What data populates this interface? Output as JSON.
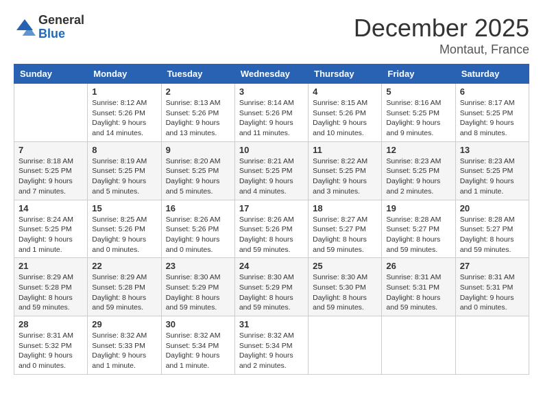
{
  "logo": {
    "general": "General",
    "blue": "Blue"
  },
  "header": {
    "month": "December 2025",
    "location": "Montaut, France"
  },
  "weekdays": [
    "Sunday",
    "Monday",
    "Tuesday",
    "Wednesday",
    "Thursday",
    "Friday",
    "Saturday"
  ],
  "weeks": [
    [
      {
        "day": "",
        "sunrise": "",
        "sunset": "",
        "daylight": ""
      },
      {
        "day": "1",
        "sunrise": "Sunrise: 8:12 AM",
        "sunset": "Sunset: 5:26 PM",
        "daylight": "Daylight: 9 hours and 14 minutes."
      },
      {
        "day": "2",
        "sunrise": "Sunrise: 8:13 AM",
        "sunset": "Sunset: 5:26 PM",
        "daylight": "Daylight: 9 hours and 13 minutes."
      },
      {
        "day": "3",
        "sunrise": "Sunrise: 8:14 AM",
        "sunset": "Sunset: 5:26 PM",
        "daylight": "Daylight: 9 hours and 11 minutes."
      },
      {
        "day": "4",
        "sunrise": "Sunrise: 8:15 AM",
        "sunset": "Sunset: 5:26 PM",
        "daylight": "Daylight: 9 hours and 10 minutes."
      },
      {
        "day": "5",
        "sunrise": "Sunrise: 8:16 AM",
        "sunset": "Sunset: 5:25 PM",
        "daylight": "Daylight: 9 hours and 9 minutes."
      },
      {
        "day": "6",
        "sunrise": "Sunrise: 8:17 AM",
        "sunset": "Sunset: 5:25 PM",
        "daylight": "Daylight: 9 hours and 8 minutes."
      }
    ],
    [
      {
        "day": "7",
        "sunrise": "Sunrise: 8:18 AM",
        "sunset": "Sunset: 5:25 PM",
        "daylight": "Daylight: 9 hours and 7 minutes."
      },
      {
        "day": "8",
        "sunrise": "Sunrise: 8:19 AM",
        "sunset": "Sunset: 5:25 PM",
        "daylight": "Daylight: 9 hours and 5 minutes."
      },
      {
        "day": "9",
        "sunrise": "Sunrise: 8:20 AM",
        "sunset": "Sunset: 5:25 PM",
        "daylight": "Daylight: 9 hours and 5 minutes."
      },
      {
        "day": "10",
        "sunrise": "Sunrise: 8:21 AM",
        "sunset": "Sunset: 5:25 PM",
        "daylight": "Daylight: 9 hours and 4 minutes."
      },
      {
        "day": "11",
        "sunrise": "Sunrise: 8:22 AM",
        "sunset": "Sunset: 5:25 PM",
        "daylight": "Daylight: 9 hours and 3 minutes."
      },
      {
        "day": "12",
        "sunrise": "Sunrise: 8:23 AM",
        "sunset": "Sunset: 5:25 PM",
        "daylight": "Daylight: 9 hours and 2 minutes."
      },
      {
        "day": "13",
        "sunrise": "Sunrise: 8:23 AM",
        "sunset": "Sunset: 5:25 PM",
        "daylight": "Daylight: 9 hours and 1 minute."
      }
    ],
    [
      {
        "day": "14",
        "sunrise": "Sunrise: 8:24 AM",
        "sunset": "Sunset: 5:25 PM",
        "daylight": "Daylight: 9 hours and 1 minute."
      },
      {
        "day": "15",
        "sunrise": "Sunrise: 8:25 AM",
        "sunset": "Sunset: 5:26 PM",
        "daylight": "Daylight: 9 hours and 0 minutes."
      },
      {
        "day": "16",
        "sunrise": "Sunrise: 8:26 AM",
        "sunset": "Sunset: 5:26 PM",
        "daylight": "Daylight: 9 hours and 0 minutes."
      },
      {
        "day": "17",
        "sunrise": "Sunrise: 8:26 AM",
        "sunset": "Sunset: 5:26 PM",
        "daylight": "Daylight: 8 hours and 59 minutes."
      },
      {
        "day": "18",
        "sunrise": "Sunrise: 8:27 AM",
        "sunset": "Sunset: 5:27 PM",
        "daylight": "Daylight: 8 hours and 59 minutes."
      },
      {
        "day": "19",
        "sunrise": "Sunrise: 8:28 AM",
        "sunset": "Sunset: 5:27 PM",
        "daylight": "Daylight: 8 hours and 59 minutes."
      },
      {
        "day": "20",
        "sunrise": "Sunrise: 8:28 AM",
        "sunset": "Sunset: 5:27 PM",
        "daylight": "Daylight: 8 hours and 59 minutes."
      }
    ],
    [
      {
        "day": "21",
        "sunrise": "Sunrise: 8:29 AM",
        "sunset": "Sunset: 5:28 PM",
        "daylight": "Daylight: 8 hours and 59 minutes."
      },
      {
        "day": "22",
        "sunrise": "Sunrise: 8:29 AM",
        "sunset": "Sunset: 5:28 PM",
        "daylight": "Daylight: 8 hours and 59 minutes."
      },
      {
        "day": "23",
        "sunrise": "Sunrise: 8:30 AM",
        "sunset": "Sunset: 5:29 PM",
        "daylight": "Daylight: 8 hours and 59 minutes."
      },
      {
        "day": "24",
        "sunrise": "Sunrise: 8:30 AM",
        "sunset": "Sunset: 5:29 PM",
        "daylight": "Daylight: 8 hours and 59 minutes."
      },
      {
        "day": "25",
        "sunrise": "Sunrise: 8:30 AM",
        "sunset": "Sunset: 5:30 PM",
        "daylight": "Daylight: 8 hours and 59 minutes."
      },
      {
        "day": "26",
        "sunrise": "Sunrise: 8:31 AM",
        "sunset": "Sunset: 5:31 PM",
        "daylight": "Daylight: 8 hours and 59 minutes."
      },
      {
        "day": "27",
        "sunrise": "Sunrise: 8:31 AM",
        "sunset": "Sunset: 5:31 PM",
        "daylight": "Daylight: 9 hours and 0 minutes."
      }
    ],
    [
      {
        "day": "28",
        "sunrise": "Sunrise: 8:31 AM",
        "sunset": "Sunset: 5:32 PM",
        "daylight": "Daylight: 9 hours and 0 minutes."
      },
      {
        "day": "29",
        "sunrise": "Sunrise: 8:32 AM",
        "sunset": "Sunset: 5:33 PM",
        "daylight": "Daylight: 9 hours and 1 minute."
      },
      {
        "day": "30",
        "sunrise": "Sunrise: 8:32 AM",
        "sunset": "Sunset: 5:34 PM",
        "daylight": "Daylight: 9 hours and 1 minute."
      },
      {
        "day": "31",
        "sunrise": "Sunrise: 8:32 AM",
        "sunset": "Sunset: 5:34 PM",
        "daylight": "Daylight: 9 hours and 2 minutes."
      },
      {
        "day": "",
        "sunrise": "",
        "sunset": "",
        "daylight": ""
      },
      {
        "day": "",
        "sunrise": "",
        "sunset": "",
        "daylight": ""
      },
      {
        "day": "",
        "sunrise": "",
        "sunset": "",
        "daylight": ""
      }
    ]
  ]
}
